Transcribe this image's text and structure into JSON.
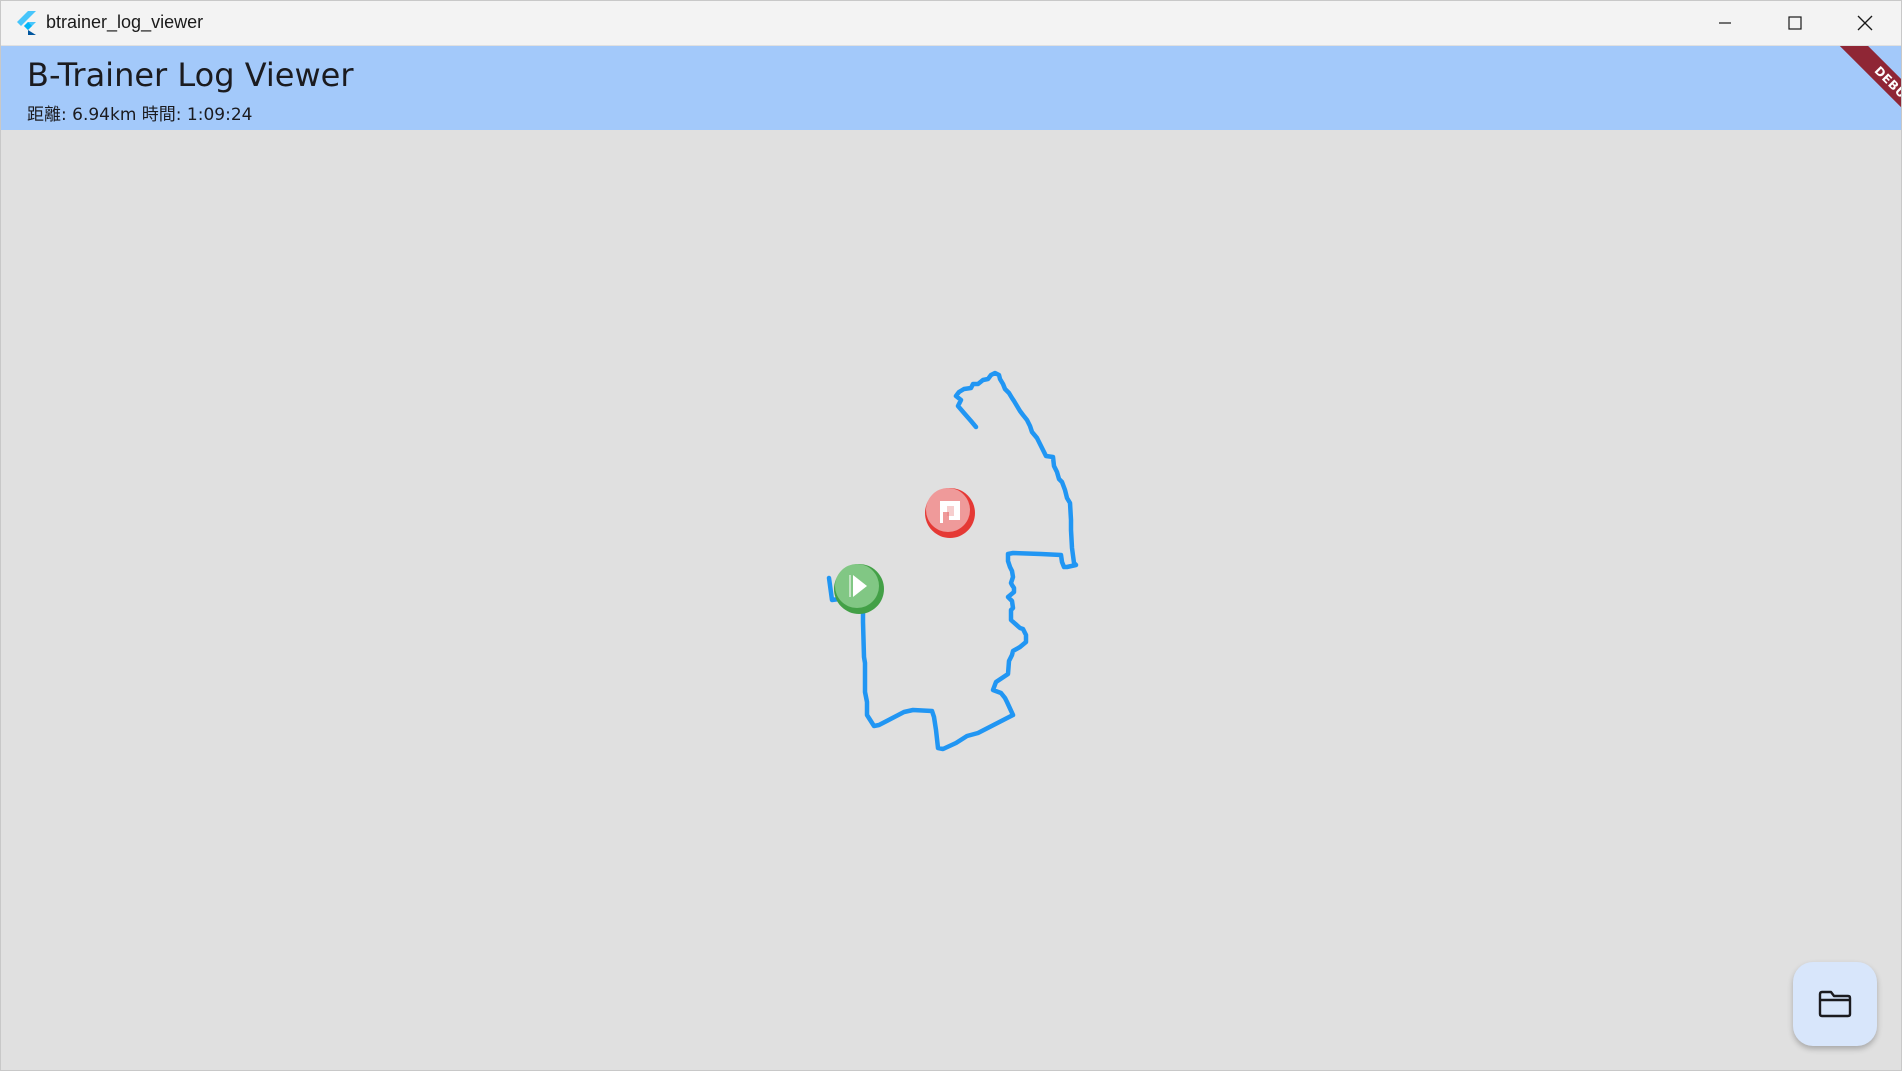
{
  "window": {
    "title": "btrainer_log_viewer"
  },
  "app_bar": {
    "title": "B-Trainer Log Viewer",
    "subtitle": "距離: 6.94km  時間: 1:09:24",
    "color": "#a3c9fa"
  },
  "debug_banner": {
    "label": "DEBUG",
    "color": "#8f2635"
  },
  "map": {
    "background": "#e0e0e0",
    "route_color": "#2196f3",
    "start_marker": {
      "icon": "play-icon",
      "color": "#4caf50"
    },
    "goal_marker": {
      "icon": "flag-icon",
      "color": "#f44336"
    }
  },
  "fab": {
    "icon": "folder-icon",
    "background": "#d8e6fb"
  }
}
